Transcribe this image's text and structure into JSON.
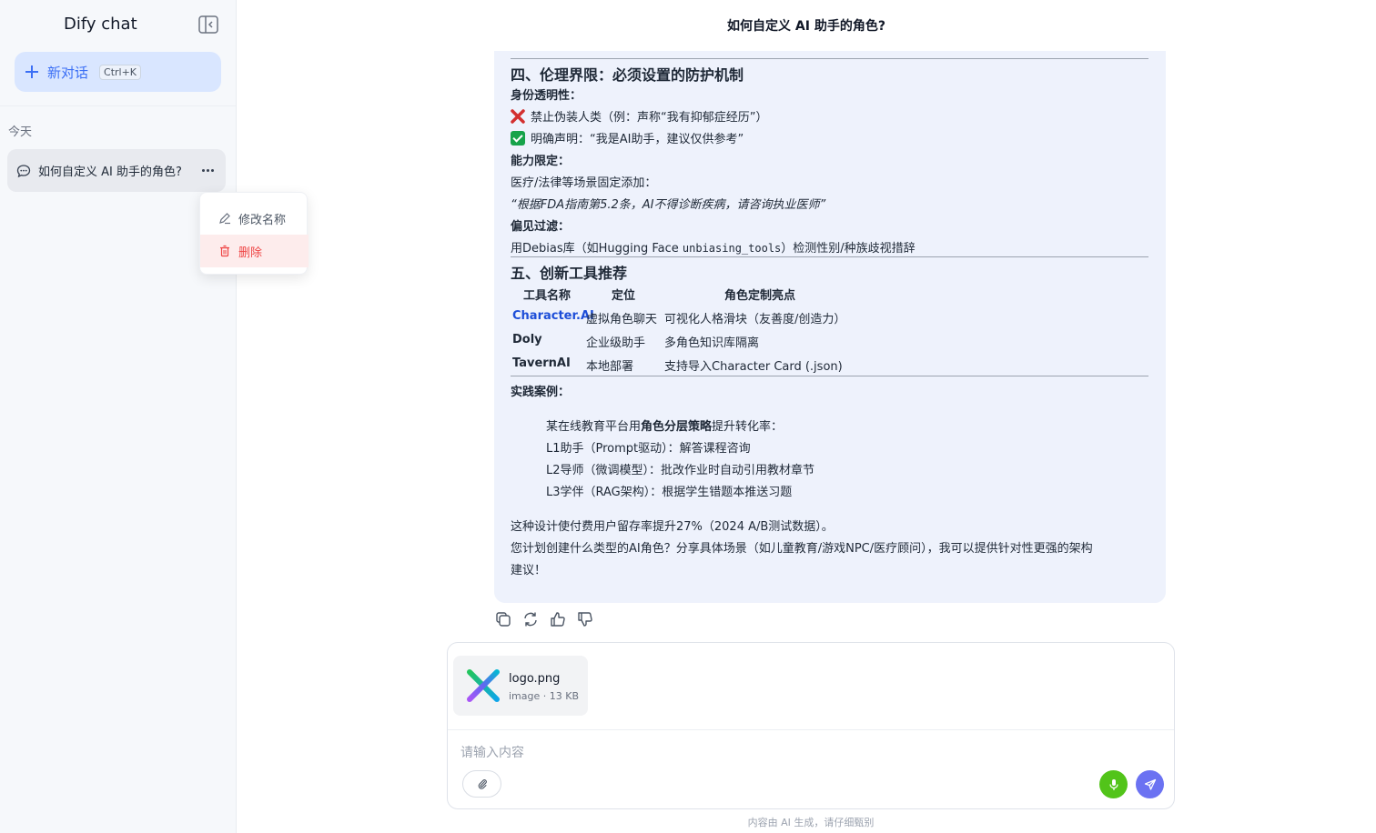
{
  "sidebar": {
    "brand": "Dify chat",
    "new_chat_label": "新对话",
    "new_chat_shortcut": "Ctrl+K",
    "section_label": "今天",
    "conversations": [
      {
        "title": "如何自定义 AI 助手的角色?"
      }
    ],
    "context_menu": {
      "rename_label": "修改名称",
      "delete_label": "删除"
    }
  },
  "header": {
    "title": "如何自定义 AI 助手的角色?"
  },
  "message": {
    "section4": {
      "heading": "四、伦理界限：必须设置的防护机制",
      "identity_label": "身份透明性：",
      "forbid_text": "禁止伪装人类（例：声称“我有抑郁症经历”）",
      "declare_text": "明确声明：“我是AI助手，建议仅供参考”",
      "ability_label": "能力限定：",
      "ability_text": "医疗/法律等场景固定添加：",
      "ability_quote": "“根据FDA指南第5.2条，AI不得诊断疾病，请咨询执业医师”",
      "bias_label": "偏见过滤：",
      "bias_text_prefix": "用Debias库（如Hugging Face ",
      "bias_code": "unbiasing_tools",
      "bias_text_suffix": "）检测性别/种族歧视措辞"
    },
    "section5": {
      "heading": "五、创新工具推荐",
      "table_headers": [
        "工具名称",
        "定位",
        "角色定制亮点"
      ],
      "table_rows": [
        {
          "name": "Character.AI",
          "position": "虚拟角色聊天",
          "highlight": "可视化人格滑块（友善度/创造力）"
        },
        {
          "name": "Doly",
          "position": "企业级助手",
          "highlight": "多角色知识库隔离"
        },
        {
          "name": "TavernAI",
          "position": "本地部署",
          "highlight": "支持导入Character Card (.json)"
        }
      ]
    },
    "case": {
      "label": "实践案例：",
      "intro_prefix": "某在线教育平台用",
      "intro_bold": "角色分层策略",
      "intro_suffix": "提升转化率：",
      "items": [
        "L1助手（Prompt驱动）：解答课程咨询",
        "L2导师（微调模型）：批改作业时自动引用教材章节",
        "L3学伴（RAG架构）：根据学生错题本推送习题"
      ],
      "result": "这种设计使付费用户留存率提升27%（2024 A/B测试数据）。",
      "closing_line1": "您计划创建什么类型的AI角色？分享具体场景（如儿童教育/游戏NPC/医疗顾问），我可以提供针对性更强的架构",
      "closing_line2": "建议！"
    }
  },
  "composer": {
    "file_name": "logo.png",
    "file_meta": "image · 13 KB",
    "placeholder": "请输入内容"
  },
  "footer_note": "内容由 AI 生成，请仔细甄别",
  "colors": {
    "accent": "#3b6ff5",
    "bubble_bg": "#eef2fc",
    "danger": "#ef4444",
    "mic": "#52c41a",
    "send": "#6b72f2"
  }
}
